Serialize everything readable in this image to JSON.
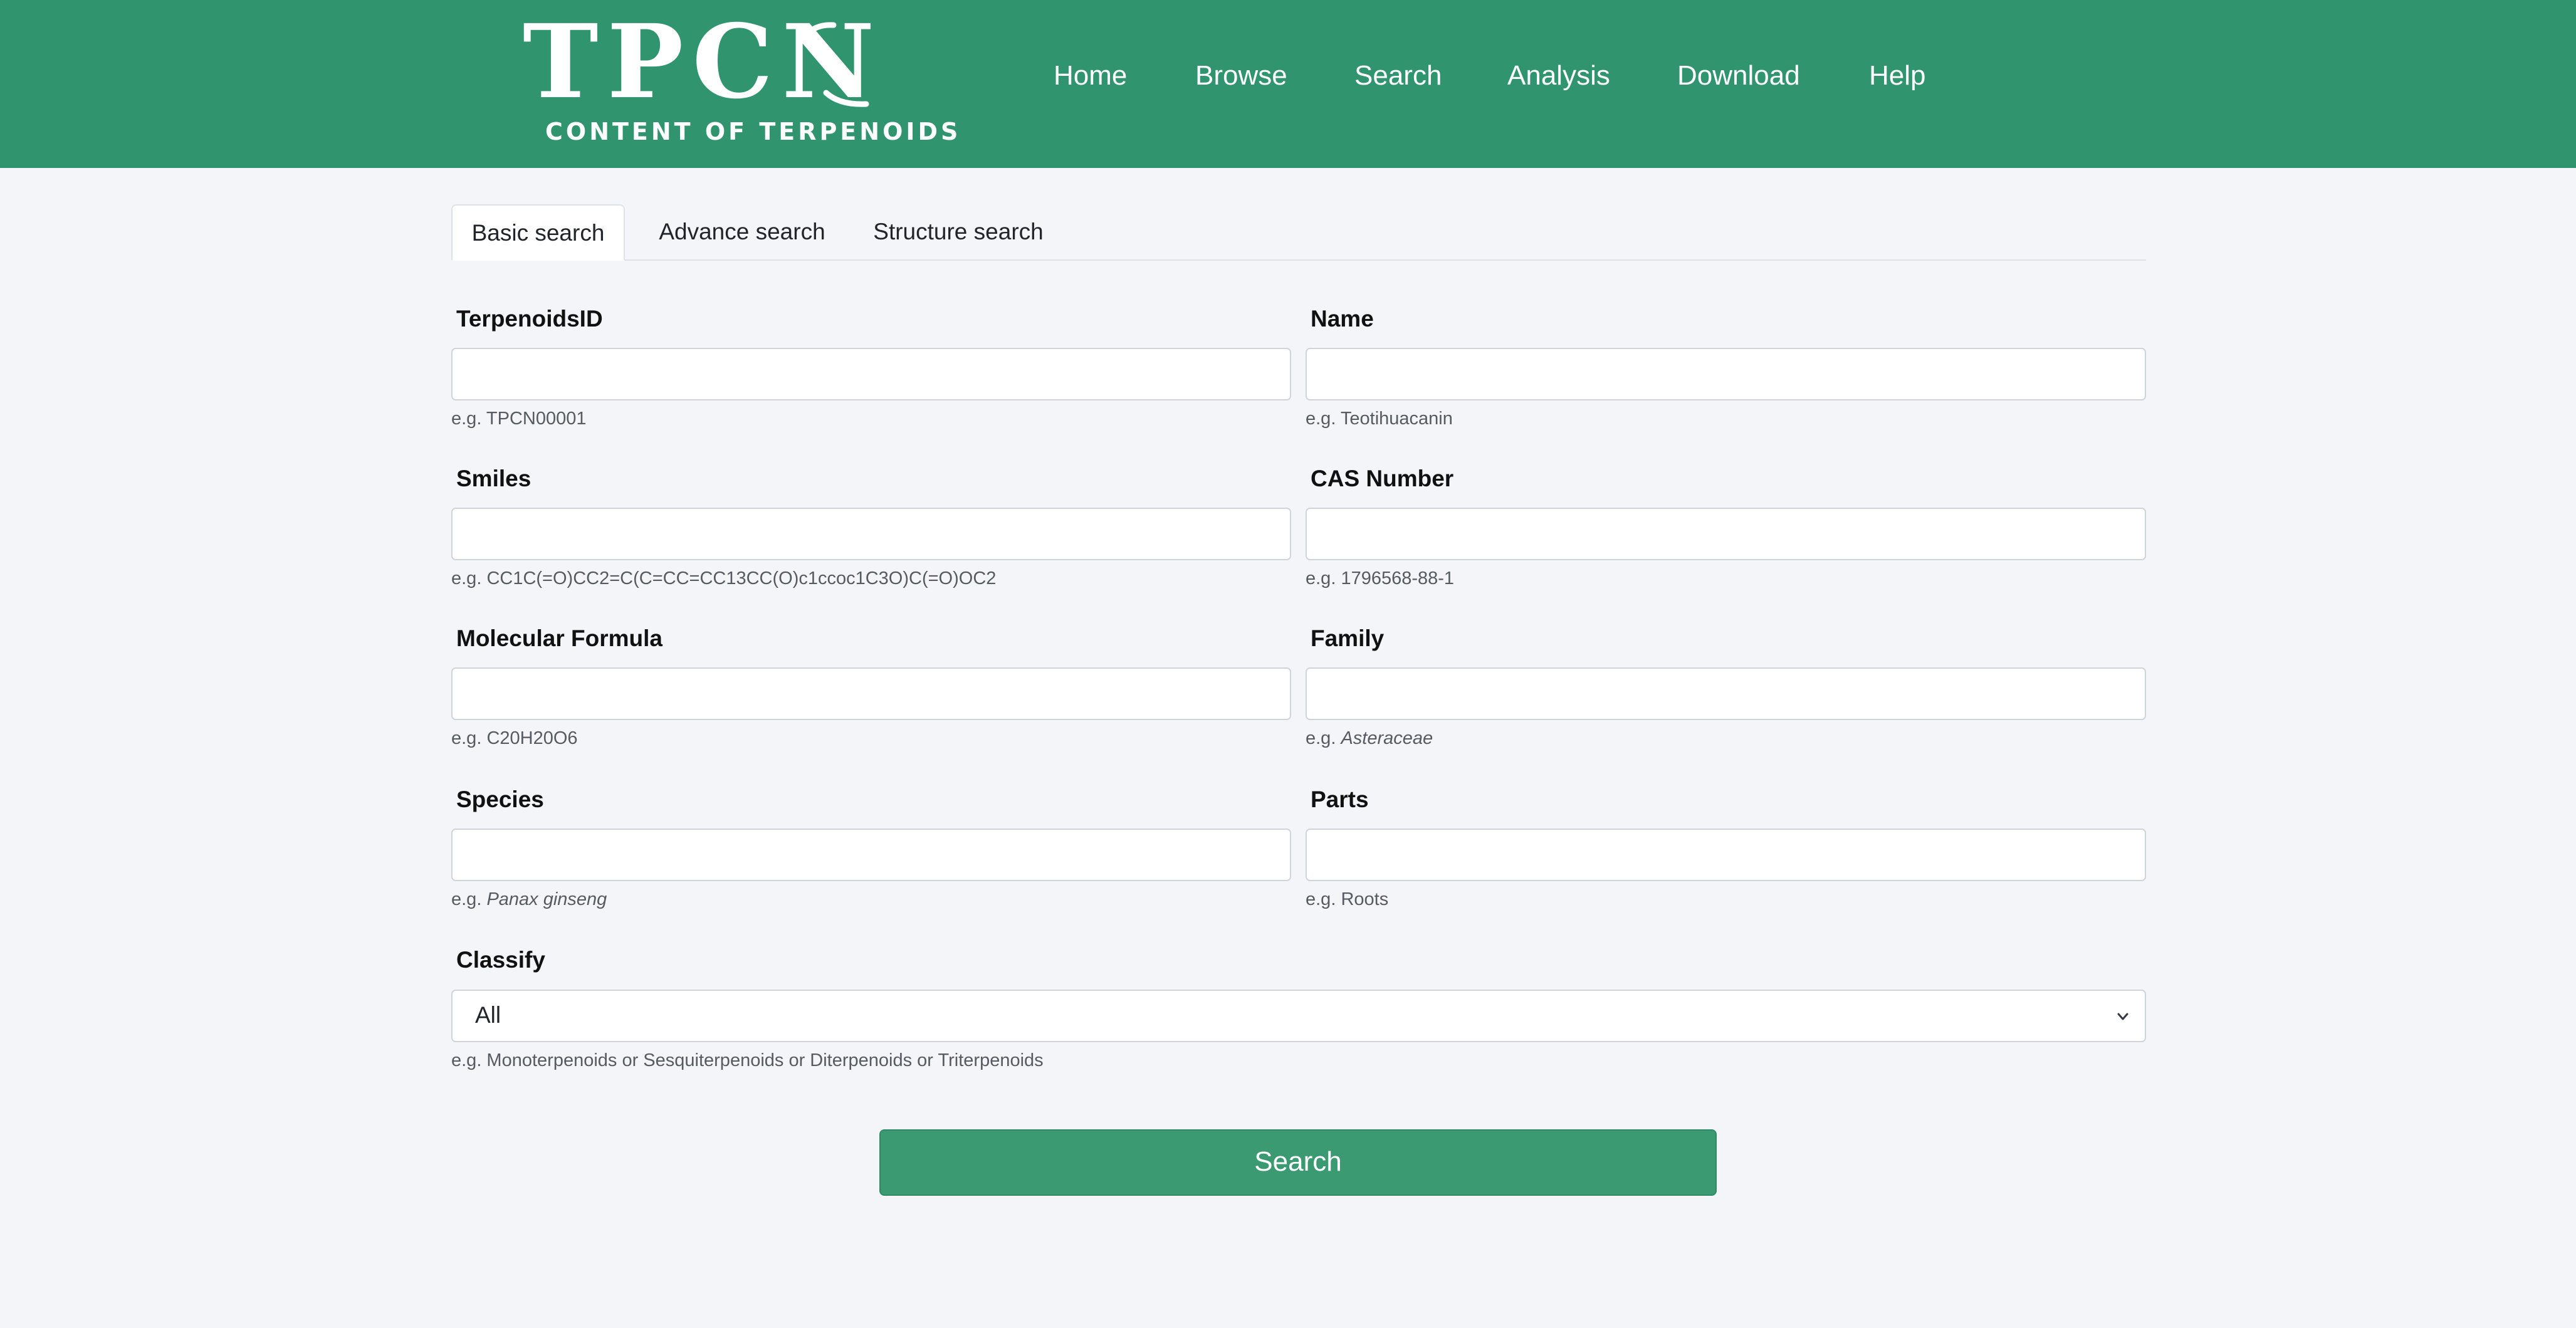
{
  "brand": {
    "logo_text": "TPCN",
    "logo_subtitle": "CONTENT OF TERPENOIDS"
  },
  "nav": {
    "items": [
      {
        "label": "Home"
      },
      {
        "label": "Browse"
      },
      {
        "label": "Search"
      },
      {
        "label": "Analysis"
      },
      {
        "label": "Download"
      },
      {
        "label": "Help"
      }
    ]
  },
  "tabs": [
    {
      "label": "Basic search",
      "active": true
    },
    {
      "label": "Advance search",
      "active": false
    },
    {
      "label": "Structure search",
      "active": false
    }
  ],
  "form": {
    "fields": [
      {
        "label": "TerpenoidsID",
        "value": "",
        "hint_prefix": "e.g. ",
        "hint_value": "TPCN00001",
        "italic": false
      },
      {
        "label": "Name",
        "value": "",
        "hint_prefix": "e.g. ",
        "hint_value": "Teotihuacanin",
        "italic": false
      },
      {
        "label": "Smiles",
        "value": "",
        "hint_prefix": "e.g. ",
        "hint_value": "CC1C(=O)CC2=C(C=CC=CC13CC(O)c1ccoc1C3O)C(=O)OC2",
        "italic": false
      },
      {
        "label": "CAS Number",
        "value": "",
        "hint_prefix": "e.g. ",
        "hint_value": "1796568-88-1",
        "italic": false
      },
      {
        "label": "Molecular Formula",
        "value": "",
        "hint_prefix": "e.g. ",
        "hint_value": "C20H20O6",
        "italic": false
      },
      {
        "label": "Family",
        "value": "",
        "hint_prefix": "e.g. ",
        "hint_value": "Asteraceae",
        "italic": true
      },
      {
        "label": "Species",
        "value": "",
        "hint_prefix": "e.g. ",
        "hint_value": "Panax ginseng",
        "italic": true
      },
      {
        "label": "Parts",
        "value": "",
        "hint_prefix": "e.g. ",
        "hint_value": "Roots",
        "italic": false
      }
    ],
    "classify": {
      "label": "Classify",
      "selected": "All",
      "hint": "e.g. Monoterpenoids or Sesquiterpenoids or Diterpenoids or Triterpenoids"
    },
    "submit_label": "Search"
  },
  "colors": {
    "header": "#30956e",
    "button": "#3c9a72",
    "background": "#f4f5f9"
  }
}
